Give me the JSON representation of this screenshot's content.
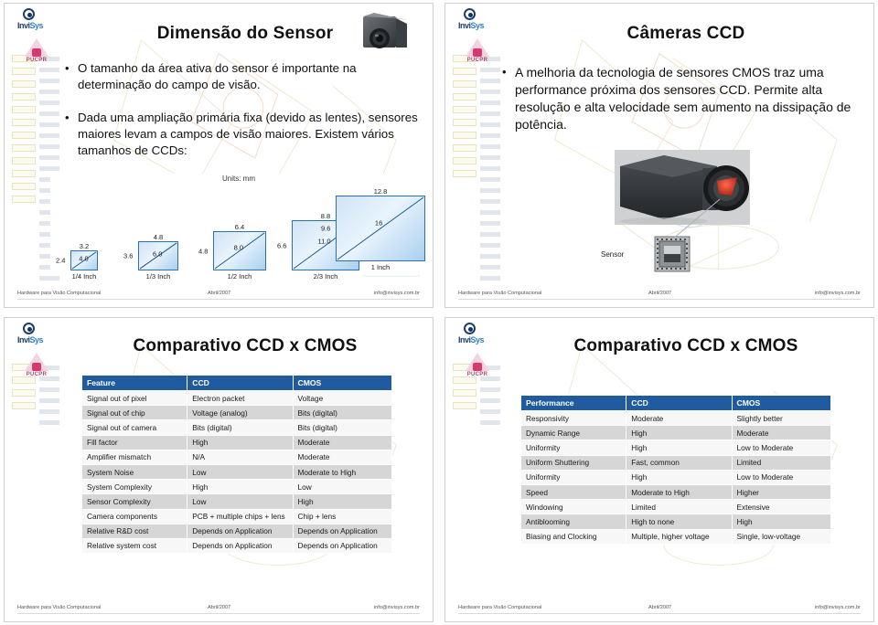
{
  "document": {
    "type": "slide-handout",
    "slide_count": 4,
    "layout": "2x2"
  },
  "branding": {
    "logo_primary": "invisys-logo",
    "logo_primary_text_a": "Invi",
    "logo_primary_text_b": "Sys",
    "logo_secondary": "pucpr-logo",
    "logo_secondary_text": "PUCPR"
  },
  "footer": {
    "left": "Hardware para Visão Computacional",
    "center": "Abril/2007",
    "right": "info@invisys.com.br"
  },
  "slides": [
    {
      "id": "slide-sensor-dimension",
      "title": "Dimensão do Sensor",
      "bullets": [
        "O tamanho da área ativa do sensor é importante na determinação do campo de visão.",
        "Dada uma ampliação primária fixa (devido as lentes), sensores maiores levam a campos de visão maiores. Existem vários tamanhos de CCDs:"
      ],
      "figure": {
        "name": "ccd-size-comparison",
        "units_label": "Units: mm",
        "sensors": [
          {
            "format": "1/4 Inch",
            "width_mm": "3.2",
            "height_mm": "2.4",
            "diagonal_mm": "4.0"
          },
          {
            "format": "1/3 Inch",
            "width_mm": "4.8",
            "height_mm": "3.6",
            "diagonal_mm": "6.0"
          },
          {
            "format": "1/2 Inch",
            "width_mm": "6.4",
            "height_mm": "4.8",
            "diagonal_mm": "8.0"
          },
          {
            "format": "2/3 Inch",
            "width_mm": "8.8",
            "height_mm": "6.6",
            "diagonal_mm": "11.0"
          },
          {
            "format": "1 Inch",
            "width_mm": "12.8",
            "height_mm": "9.6",
            "diagonal_mm": "16"
          }
        ]
      }
    },
    {
      "id": "slide-ccd-cameras",
      "title": "Câmeras CCD",
      "bullets": [
        "A melhoria da tecnologia de sensores CMOS traz uma performance próxima dos sensores CCD. Permite alta resolução e alta velocidade sem aumento na dissipação de potência."
      ],
      "figure": {
        "name": "camera-sensor-callout",
        "callout_label": "Sensor"
      }
    },
    {
      "id": "slide-comparison-features",
      "title": "Comparativo CCD x CMOS",
      "table": {
        "name": "ccd-cmos-feature-table",
        "headers": [
          "Feature",
          "CCD",
          "CMOS"
        ],
        "rows": [
          [
            "Signal out of pixel",
            "Electron packet",
            "Voltage"
          ],
          [
            "Signal out of chip",
            "Voltage (analog)",
            "Bits (digital)"
          ],
          [
            "Signal out of camera",
            "Bits (digital)",
            "Bits (digital)"
          ],
          [
            "Fill factor",
            "High",
            "Moderate"
          ],
          [
            "Amplifier mismatch",
            "N/A",
            "Moderate"
          ],
          [
            "System Noise",
            "Low",
            "Moderate to High"
          ],
          [
            "System Complexity",
            "High",
            "Low"
          ],
          [
            "Sensor Complexity",
            "Low",
            "High"
          ],
          [
            "Camera components",
            "PCB + multiple chips + lens",
            "Chip + lens"
          ],
          [
            "Relative R&D cost",
            "Depends on Application",
            "Depends on Application"
          ],
          [
            "Relative system cost",
            "Depends on Application",
            "Depends on Application"
          ]
        ]
      }
    },
    {
      "id": "slide-comparison-performance",
      "title": "Comparativo CCD x CMOS",
      "table": {
        "name": "ccd-cmos-performance-table",
        "headers": [
          "Performance",
          "CCD",
          "CMOS"
        ],
        "rows": [
          [
            "Responsivity",
            "Moderate",
            "Slightly better"
          ],
          [
            "Dynamic Range",
            "High",
            "Moderate"
          ],
          [
            "Uniformity",
            "High",
            "Low to Moderate"
          ],
          [
            "Uniform Shuttering",
            "Fast, common",
            "Limited"
          ],
          [
            "Uniformity",
            "High",
            "Low to Moderate"
          ],
          [
            "Speed",
            "Moderate to High",
            "Higher"
          ],
          [
            "Windowing",
            "Limited",
            "Extensive"
          ],
          [
            "Antiblooming",
            "High to none",
            "High"
          ],
          [
            "Biasing and Clocking",
            "Multiple, higher voltage",
            "Single, low-voltage"
          ]
        ]
      }
    }
  ],
  "colors": {
    "table_header_bg": "#1f5b9e",
    "table_row_alt_bg": "#d6d6d6",
    "table_row_bg": "#f7f7f7",
    "sensor_fill": "#cfe4f7",
    "sensor_stroke": "#2a6fb0"
  }
}
